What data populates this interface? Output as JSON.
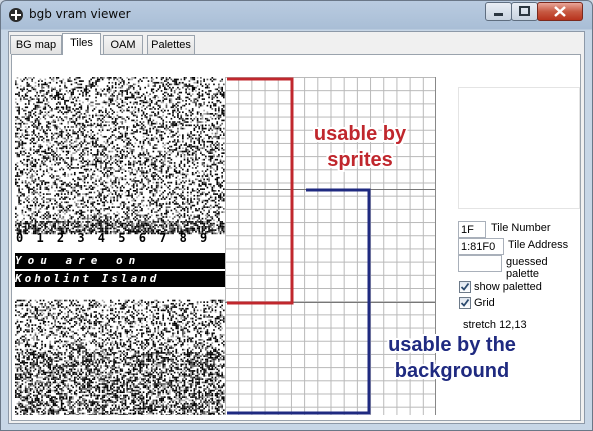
{
  "window": {
    "title": "bgb vram viewer"
  },
  "tabs": [
    {
      "label": "BG map",
      "active": false
    },
    {
      "label": "Tiles",
      "active": true
    },
    {
      "label": "OAM",
      "active": false
    },
    {
      "label": "Palettes",
      "active": false
    }
  ],
  "tiles": {
    "digits_row": "0 1 2 3 4 5 6 7 8 9",
    "text_row1": "You are on",
    "text_row2": "Koholint Island"
  },
  "annotations": {
    "sprites": "usable by\nsprites",
    "background": "usable by the\nbackground",
    "sprites_color": "#c0272d",
    "background_color": "#1f2a80"
  },
  "info": {
    "tile_number_value": "1F",
    "tile_number_label": "Tile Number",
    "tile_address_value": "1:81F0",
    "tile_address_label": "Tile Address",
    "guessed_palette_value": "",
    "guessed_palette_label": "guessed palette",
    "show_paletted_label": "show paletted",
    "show_paletted_checked": true,
    "grid_label": "Grid",
    "grid_checked": true,
    "stretch_text": "stretch 12,13"
  }
}
